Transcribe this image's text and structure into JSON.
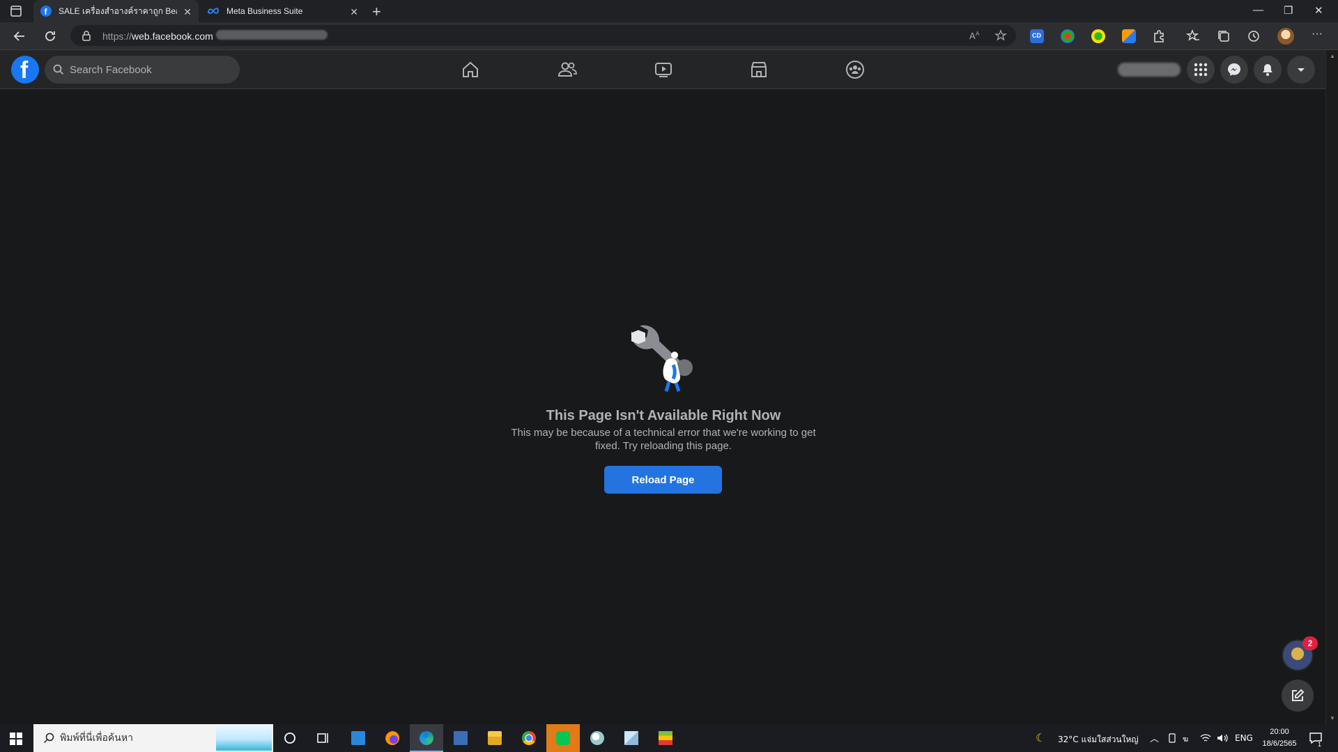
{
  "browser": {
    "tabs": [
      {
        "title": "SALE เครื่องสำอางค์ราคาถูก Beauty",
        "active": true,
        "icon": "facebook-favicon"
      },
      {
        "title": "Meta Business Suite",
        "active": false,
        "icon": "meta-favicon"
      }
    ],
    "address": {
      "prefix": "https://",
      "host": "web.facebook.com"
    }
  },
  "facebook": {
    "logo_letter": "f",
    "search_placeholder": "Search Facebook",
    "nav": [
      "home-icon",
      "friends-icon",
      "watch-icon",
      "marketplace-icon",
      "groups-icon"
    ]
  },
  "error": {
    "title": "This Page Isn't Available Right Now",
    "description": "This may be because of a technical error that we're working to get fixed. Try reloading this page.",
    "button": "Reload Page"
  },
  "floating": {
    "badge_count": "2"
  },
  "taskbar": {
    "search_placeholder": "พิมพ์ที่นี่เพื่อค้นหา",
    "weather": "32°C  แจ่มใสส่วนใหญ่",
    "language": "ENG",
    "time": "20:00",
    "date": "18/6/2565",
    "notification_count": "1"
  },
  "colors": {
    "facebook_blue": "#1877f2",
    "reload_button": "#2374e1",
    "badge_red": "#e41e3f",
    "page_bg": "#18191a",
    "header_bg": "#242526"
  }
}
